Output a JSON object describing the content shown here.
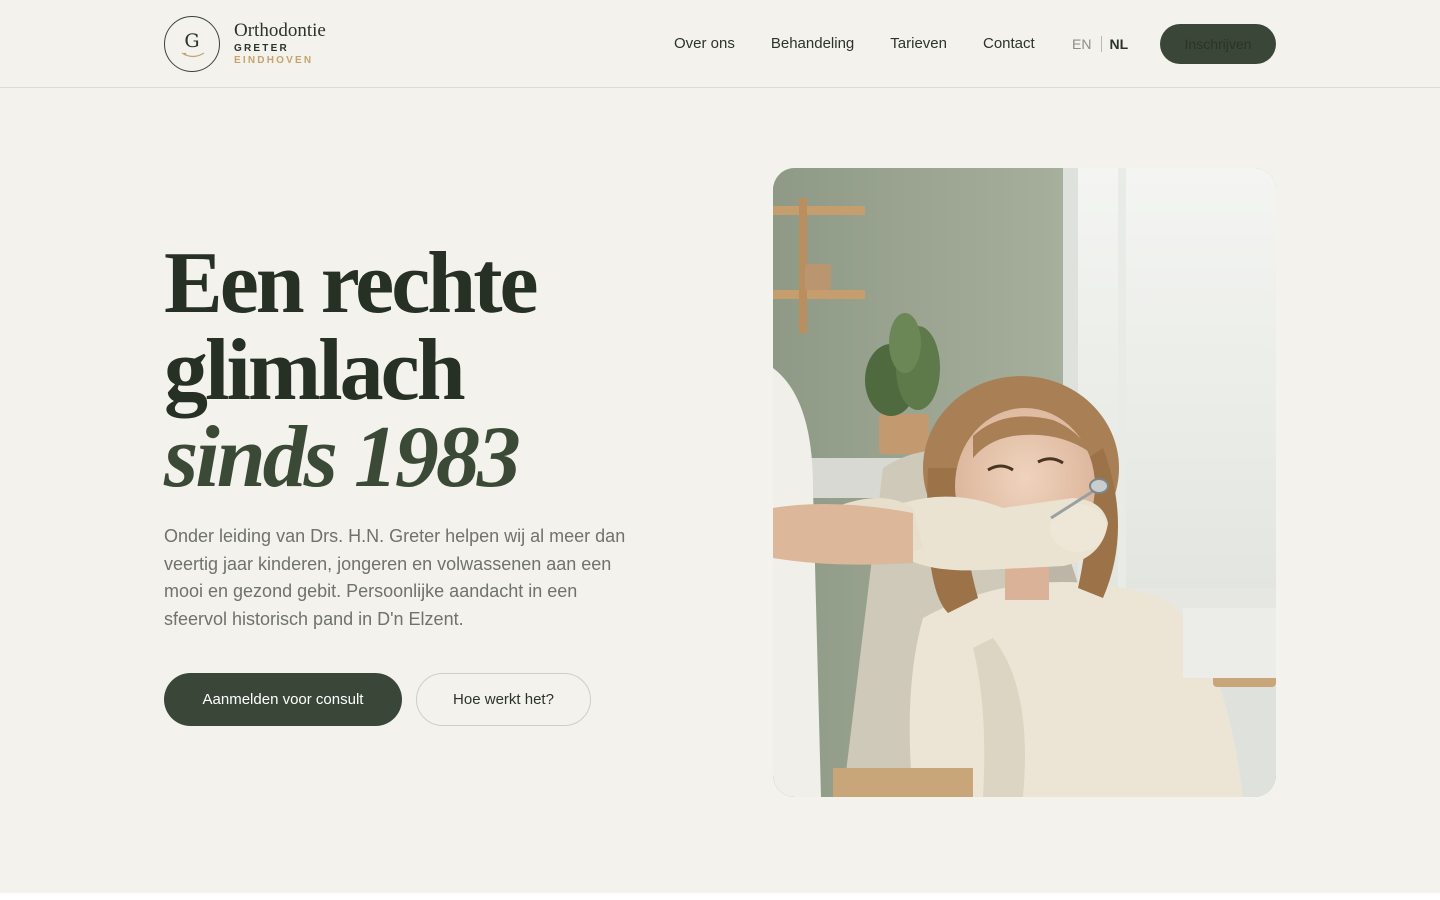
{
  "brand": {
    "logo_letter": "G",
    "title": "Orthodontie",
    "subtitle": "GRETER",
    "location": "EINDHOVEN"
  },
  "nav": {
    "items": [
      "Over ons",
      "Behandeling",
      "Tarieven",
      "Contact"
    ]
  },
  "lang": {
    "en": "EN",
    "nl": "NL",
    "active": "NL"
  },
  "header_button": "Inschrijven",
  "hero": {
    "headline_line1": "Een rechte",
    "headline_line2": "glimlach",
    "headline_line3": "sinds 1983",
    "lead": "Onder leiding van Drs. H.N. Greter helpen wij al meer dan veertig jaar kinderen, jongeren en volwassenen aan een mooi en gezond gebit. Persoonlijke aandacht in een sfeervol historisch pand in D'n Elzent.",
    "primary_button": "Aanmelden voor consult",
    "secondary_button": "Hoe werkt het?"
  },
  "colors": {
    "background": "#f3f2ed",
    "primary": "#3a4738",
    "accent_gold": "#c5a36c",
    "text": "#2c3329"
  }
}
